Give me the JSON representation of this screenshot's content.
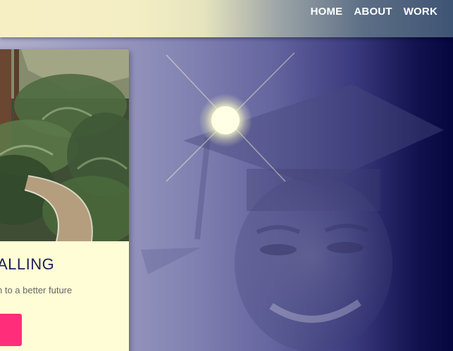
{
  "nav": {
    "items": [
      {
        "label": "HOME"
      },
      {
        "label": "ABOUT"
      },
      {
        "label": "WORK"
      }
    ]
  },
  "card": {
    "title": "ALLING",
    "description": "n to a better future"
  },
  "colors": {
    "background_dark": "#05053f",
    "header_light": "#f7efc4",
    "card_background": "#fffdd6",
    "accent_pink": "#ff2d7a",
    "title_navy": "#1e1e5a"
  },
  "icons": {
    "sparkle": "starburst-icon"
  }
}
